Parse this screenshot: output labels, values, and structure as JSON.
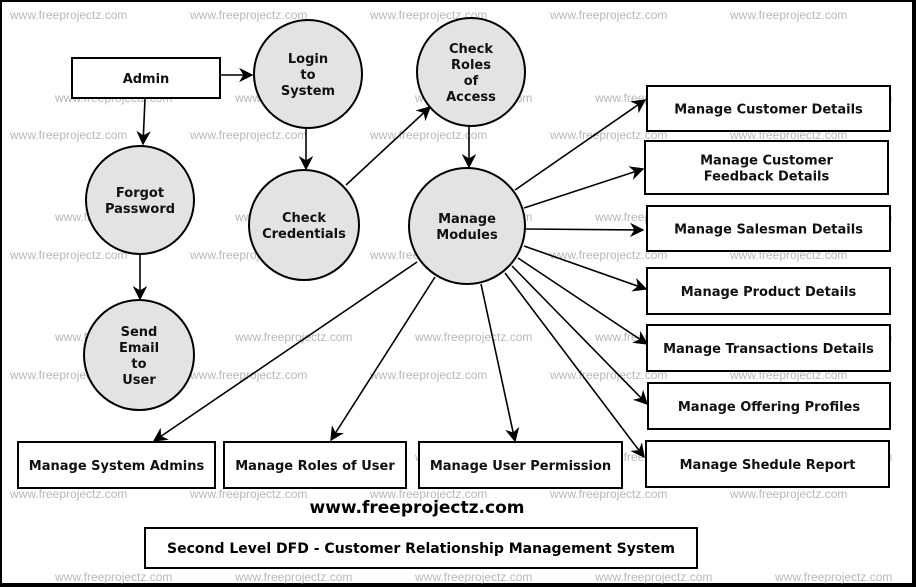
{
  "watermark": "www.freeprojectz.com",
  "site_label": "www.freeprojectz.com",
  "title": "Second Level DFD - Customer Relationship Management System",
  "colors": {
    "process_fill": "#e3e3e3",
    "stroke": "#000000",
    "watermark": "#b8b8b8",
    "background": "#ffffff"
  },
  "entities": [
    {
      "id": "admin",
      "lines": [
        "Admin"
      ]
    }
  ],
  "processes": [
    {
      "id": "login",
      "lines": [
        "Login",
        "to",
        "System"
      ]
    },
    {
      "id": "check_roles",
      "lines": [
        "Check",
        "Roles",
        "of",
        "Access"
      ]
    },
    {
      "id": "forgot",
      "lines": [
        "Forgot",
        "Password"
      ]
    },
    {
      "id": "check_cred",
      "lines": [
        "Check",
        "Credentials"
      ]
    },
    {
      "id": "manage_modules",
      "lines": [
        "Manage",
        "Modules"
      ]
    },
    {
      "id": "send_email",
      "lines": [
        "Send",
        "Email",
        "to",
        "User"
      ]
    }
  ],
  "modules": [
    {
      "id": "customer",
      "lines": [
        "Manage Customer Details"
      ]
    },
    {
      "id": "feedback",
      "lines": [
        "Manage Customer",
        "Feedback Details"
      ]
    },
    {
      "id": "salesman",
      "lines": [
        "Manage Salesman Details"
      ]
    },
    {
      "id": "product",
      "lines": [
        "Manage Product Details"
      ]
    },
    {
      "id": "transactions",
      "lines": [
        "Manage Transactions Details"
      ]
    },
    {
      "id": "offering",
      "lines": [
        "Manage Offering Profiles"
      ]
    },
    {
      "id": "schedule",
      "lines": [
        "Manage Shedule Report"
      ]
    },
    {
      "id": "sysadmins",
      "lines": [
        "Manage System Admins"
      ]
    },
    {
      "id": "roles",
      "lines": [
        "Manage Roles of User"
      ]
    },
    {
      "id": "permission",
      "lines": [
        "Manage User Permission"
      ]
    }
  ],
  "flows": [
    {
      "from": "admin",
      "to": "login"
    },
    {
      "from": "admin",
      "to": "forgot"
    },
    {
      "from": "login",
      "to": "check_cred"
    },
    {
      "from": "check_cred",
      "to": "check_roles"
    },
    {
      "from": "check_roles",
      "to": "manage_modules"
    },
    {
      "from": "forgot",
      "to": "send_email"
    },
    {
      "from": "manage_modules",
      "to": "customer"
    },
    {
      "from": "manage_modules",
      "to": "feedback"
    },
    {
      "from": "manage_modules",
      "to": "salesman"
    },
    {
      "from": "manage_modules",
      "to": "product"
    },
    {
      "from": "manage_modules",
      "to": "transactions"
    },
    {
      "from": "manage_modules",
      "to": "offering"
    },
    {
      "from": "manage_modules",
      "to": "schedule"
    },
    {
      "from": "manage_modules",
      "to": "sysadmins"
    },
    {
      "from": "manage_modules",
      "to": "roles"
    },
    {
      "from": "manage_modules",
      "to": "permission"
    }
  ]
}
